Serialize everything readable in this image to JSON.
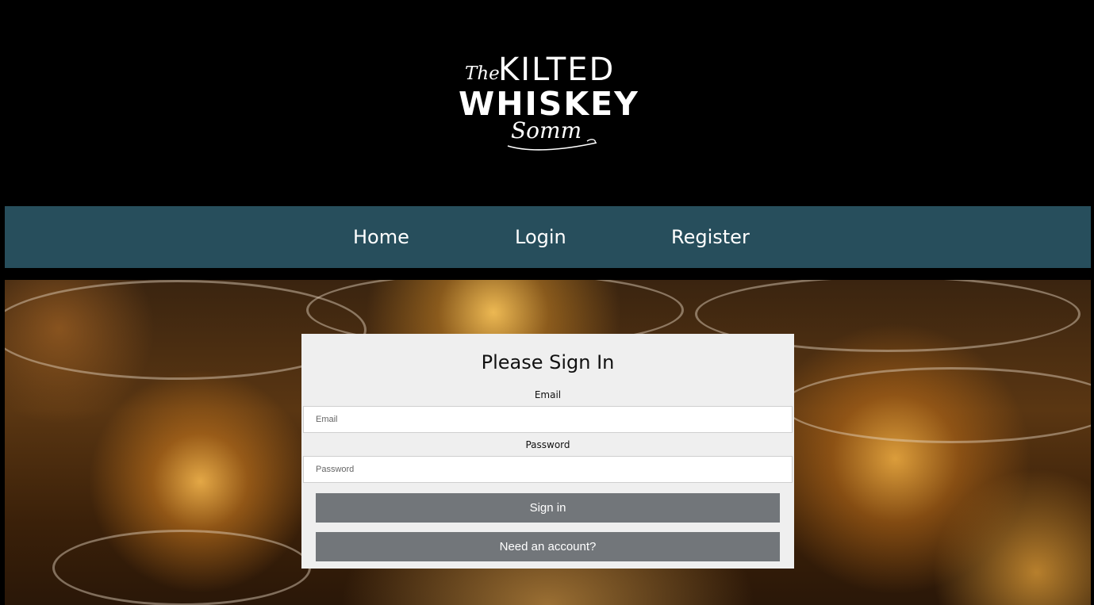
{
  "logo": {
    "line1_prefix": "The",
    "line1": "KILTED",
    "line2": "WHISKEY",
    "line3": "Somm"
  },
  "nav": {
    "home": "Home",
    "login": "Login",
    "register": "Register"
  },
  "signin": {
    "title": "Please Sign In",
    "email_label": "Email",
    "email_placeholder": "Email",
    "password_label": "Password",
    "password_placeholder": "Password",
    "signin_button": "Sign in",
    "register_button": "Need an account?"
  },
  "colors": {
    "nav_background": "#274e5c",
    "button_background": "#72767a",
    "card_background": "#efefef",
    "page_background": "#000000"
  }
}
